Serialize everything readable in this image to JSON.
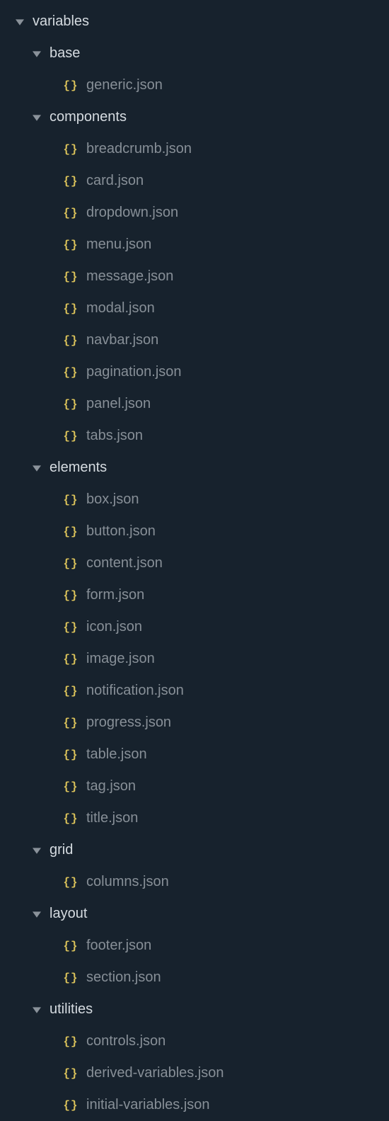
{
  "tree": {
    "root": {
      "label": "variables",
      "expanded": true
    },
    "folders": [
      {
        "label": "base",
        "files": [
          {
            "label": "generic.json"
          }
        ]
      },
      {
        "label": "components",
        "files": [
          {
            "label": "breadcrumb.json"
          },
          {
            "label": "card.json"
          },
          {
            "label": "dropdown.json"
          },
          {
            "label": "menu.json"
          },
          {
            "label": "message.json"
          },
          {
            "label": "modal.json"
          },
          {
            "label": "navbar.json"
          },
          {
            "label": "pagination.json"
          },
          {
            "label": "panel.json"
          },
          {
            "label": "tabs.json"
          }
        ]
      },
      {
        "label": "elements",
        "files": [
          {
            "label": "box.json"
          },
          {
            "label": "button.json"
          },
          {
            "label": "content.json"
          },
          {
            "label": "form.json"
          },
          {
            "label": "icon.json"
          },
          {
            "label": "image.json"
          },
          {
            "label": "notification.json"
          },
          {
            "label": "progress.json"
          },
          {
            "label": "table.json"
          },
          {
            "label": "tag.json"
          },
          {
            "label": "title.json"
          }
        ]
      },
      {
        "label": "grid",
        "files": [
          {
            "label": "columns.json"
          }
        ]
      },
      {
        "label": "layout",
        "files": [
          {
            "label": "footer.json"
          },
          {
            "label": "section.json"
          }
        ]
      },
      {
        "label": "utilities",
        "files": [
          {
            "label": "controls.json"
          },
          {
            "label": "derived-variables.json"
          },
          {
            "label": "initial-variables.json"
          }
        ]
      }
    ]
  },
  "icons": {
    "json_braces": "{}"
  }
}
